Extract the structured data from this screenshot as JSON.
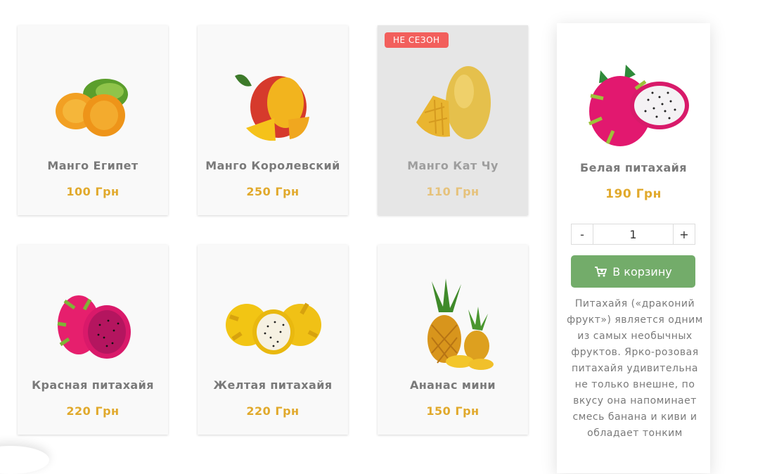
{
  "products": [
    {
      "name": "Манго Египет",
      "price": "100 Грн",
      "icon": "mango-egypt-image"
    },
    {
      "name": "Манго Королевский",
      "price": "250 Грн",
      "icon": "mango-royal-image"
    },
    {
      "name": "Манго Кат Чу",
      "price": "110 Грн",
      "icon": "mango-kat-chu-image",
      "badge": "НЕ СЕЗОН"
    },
    {
      "name": "Белая питахайя",
      "price": "190 Грн",
      "icon": "white-pitahaya-image"
    },
    {
      "name": "Красная питахайя",
      "price": "220 Грн",
      "icon": "red-pitahaya-image"
    },
    {
      "name": "Желтая питахайя",
      "price": "220 Грн",
      "icon": "yellow-pitahaya-image"
    },
    {
      "name": "Ананас мини",
      "price": "150 Грн",
      "icon": "mini-pineapple-image"
    }
  ],
  "expanded": {
    "qty_minus": "-",
    "qty_value": "1",
    "qty_plus": "+",
    "cart_label": "В корзину",
    "description": "Питахайя («драконий фрукт») является одним из самых необычных фруктов. Ярко-розовая питахайя удивительна не только внешне, по вкусу она напоминает смесь банана и киви и обладает тонким"
  },
  "colors": {
    "price": "#e1a92c",
    "name": "#7a7a7a",
    "badge": "#f25f5c",
    "cart_button": "#73ac6a",
    "card_bg": "#f9f9f9",
    "card_off_bg": "#e6e6e6"
  }
}
